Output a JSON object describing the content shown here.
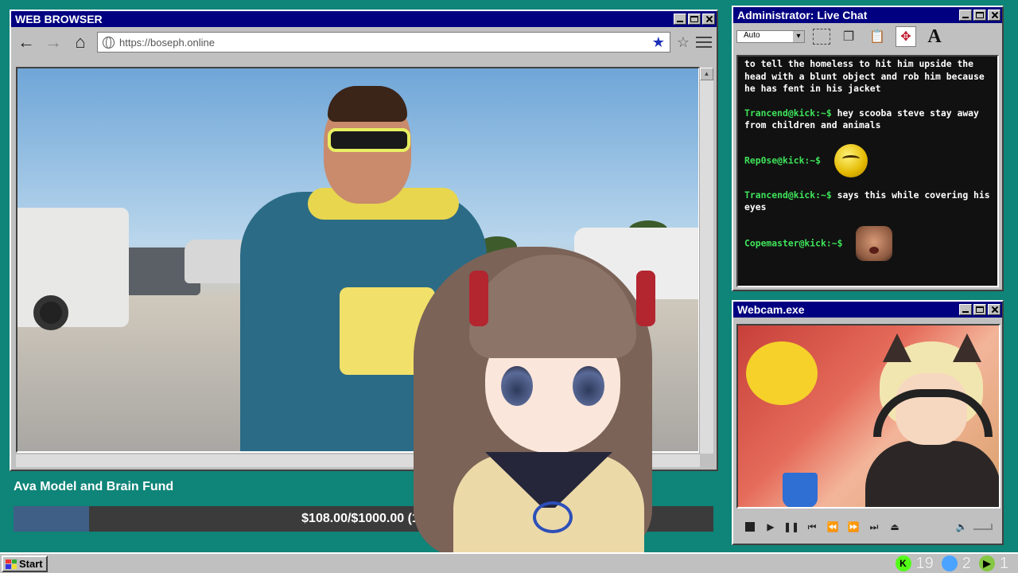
{
  "browser": {
    "title": "WEB BROWSER",
    "url": "https://boseph.online"
  },
  "goal": {
    "title": "Ava Model and Brain Fund",
    "progress_text": "$108.00/$1000.00 (11",
    "progress_fraction": 0.108
  },
  "chat": {
    "title": "Administrator: Live Chat",
    "font_select": "Auto",
    "messages": [
      {
        "user": "",
        "text": "to tell the homeless to hit him upside the head with a blunt object and rob him because he has fent in his jacket",
        "emote": ""
      },
      {
        "user": "Trancend@kick:~$",
        "text": "hey scooba steve stay away from children and animals",
        "emote": ""
      },
      {
        "user": "Rep0se@kick:~$",
        "text": "",
        "emote": "angry-emoji-icon"
      },
      {
        "user": "Trancend@kick:~$",
        "text": "says this while covering his eyes",
        "emote": ""
      },
      {
        "user": "Copemaster@kick:~$",
        "text": "",
        "emote": "face-emote-icon"
      }
    ]
  },
  "webcam": {
    "title": "Webcam.exe"
  },
  "taskbar": {
    "start_label": "Start",
    "tray": [
      {
        "icon": "kick-icon",
        "value": "19",
        "color": "#53fc18"
      },
      {
        "icon": "moon-icon",
        "value": "2",
        "color": "#4aa3ff"
      },
      {
        "icon": "rumble-icon",
        "value": "1",
        "color": "#85c742"
      }
    ]
  },
  "colors": {
    "desktop": "#0f8478",
    "titlebar": "#000080",
    "chat_user": "#3ee35a",
    "goal_fill": "#3f5f86"
  }
}
